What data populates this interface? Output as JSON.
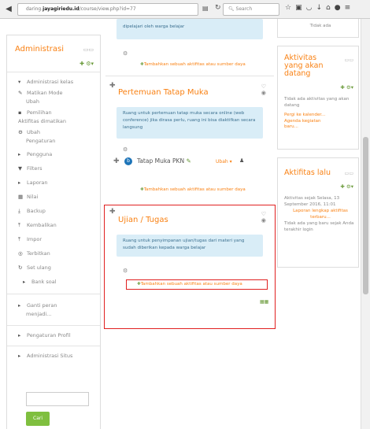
{
  "browser": {
    "url_prefix": "daring.",
    "url_domain": "jayagiriedu.id",
    "url_rest": "/course/view.php?id=77",
    "search_placeholder": "Search",
    "back_icon": "back-arrow-icon",
    "reload_icon": "reload-icon"
  },
  "left_sidebar": {
    "title": "Administrasi",
    "items": [
      {
        "icon": "caret-down-icon",
        "glyph": "▾",
        "label": "Administrasi kelas"
      },
      {
        "icon": "pencil-icon",
        "glyph": "✎",
        "label": "Matikan Mode"
      },
      {
        "icon": "",
        "glyph": "",
        "label": "Ubah"
      },
      {
        "icon": "bullet-icon",
        "glyph": "▪",
        "label": "Pemilihan"
      },
      {
        "icon": "",
        "glyph": "",
        "label": "Aktifitas dimatikan"
      },
      {
        "icon": "gear-icon",
        "glyph": "⚙",
        "label": "Ubah"
      },
      {
        "icon": "",
        "glyph": "",
        "label": "Pengaturan"
      },
      {
        "icon": "caret-right-icon",
        "glyph": "▸",
        "label": "Pengguna"
      },
      {
        "icon": "filter-icon",
        "glyph": "▼",
        "label": "Filters"
      },
      {
        "icon": "caret-right-icon",
        "glyph": "▸",
        "label": "Laporan"
      },
      {
        "icon": "grades-icon",
        "glyph": "▦",
        "label": "Nilai"
      },
      {
        "icon": "backup-icon",
        "glyph": "⤓",
        "label": "Backup"
      },
      {
        "icon": "restore-icon",
        "glyph": "⤒",
        "label": "Kembalikan"
      },
      {
        "icon": "import-icon",
        "glyph": "⤒",
        "label": "Impor"
      },
      {
        "icon": "publish-icon",
        "glyph": "◎",
        "label": "Terbitkan"
      },
      {
        "icon": "reset-icon",
        "glyph": "↻",
        "label": "Set ulang"
      },
      {
        "icon": "caret-right-icon",
        "glyph": "▸",
        "label": "Bank soal"
      },
      {
        "icon": "caret-right-icon",
        "glyph": "▸",
        "label": "Ganti peran"
      },
      {
        "icon": "",
        "glyph": "",
        "label": "menjadi..."
      },
      {
        "icon": "caret-right-icon",
        "glyph": "▸",
        "label": "Pengaturan Profil"
      },
      {
        "icon": "caret-right-icon",
        "glyph": "▸",
        "label": "Administrasi Situs"
      }
    ],
    "search_button": "Cari"
  },
  "center": {
    "top_summary": "dipelajari oleh warga belajar",
    "add_activity": "Tambahkan sebuah aktifitas atau sumber daya",
    "section1": {
      "title": "Pertemuan Tatap Muka",
      "summary": "Ruang untuk pertemuan tatap muka secara online (web conference) jika dirasa perlu, ruang ini bisa diaktifkan secara langsung",
      "activity_name": "Tatap Muka PKN",
      "activity_edit": "Ubah ▾"
    },
    "section2": {
      "title": "Ujian / Tugas",
      "summary": "Ruang untuk penyimpanan ujian/tugas dari materi yang sudah diberikan kepada warga belajar"
    }
  },
  "right_sidebar": {
    "top_text": "Tidak ada",
    "upcoming": {
      "title_lines": [
        "Aktivitas",
        "yang akan",
        "datang"
      ],
      "text": "Tidak ada aktivitas yang akan datang",
      "links": [
        "Pergi ke kalender...",
        "Agenda kegiatan",
        "baru..."
      ]
    },
    "recent": {
      "title": "Aktifitas lalu",
      "since": "Aktivitas sejak Selasa, 13 September 2016, 11:01",
      "report_link": "Laporan lengkap aktifitas terbaru...",
      "none": "Tidak ada yang baru sejak Anda terakhir login"
    }
  }
}
